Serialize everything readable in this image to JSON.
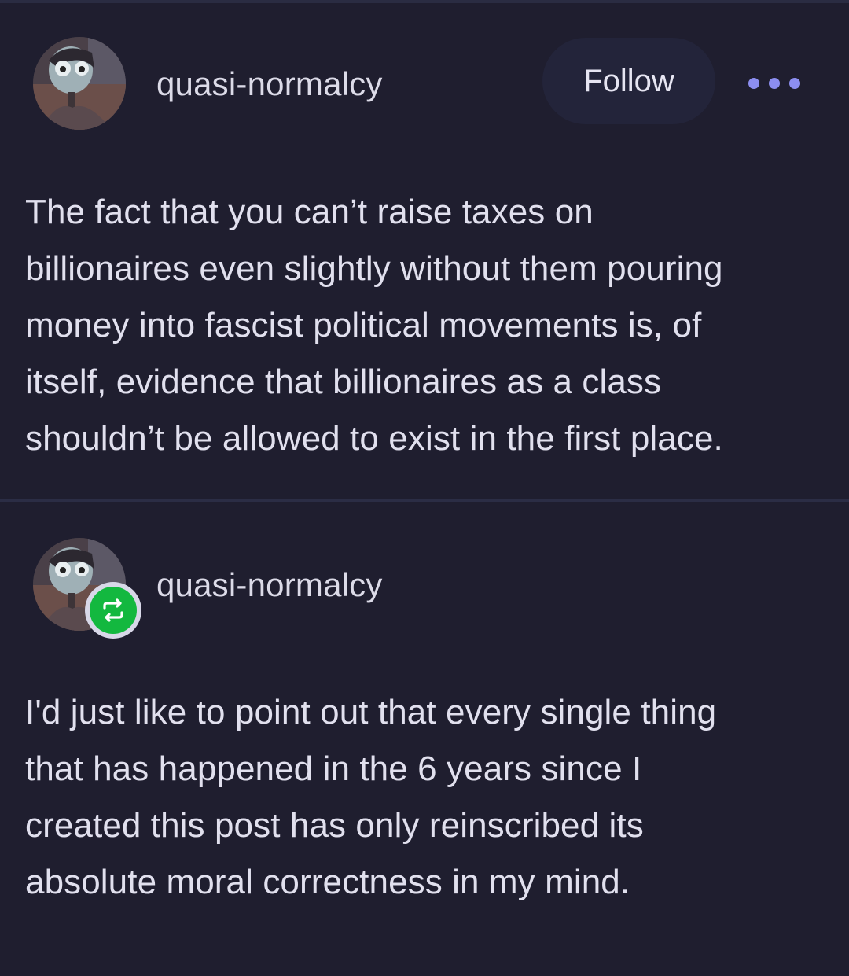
{
  "colors": {
    "background": "#1f1e2f",
    "accent_dots": "#8c8ef0",
    "reblog_green": "#13b83f",
    "follow_button_bg": "#23243a"
  },
  "original_post": {
    "username": "quasi-normalcy",
    "follow_label": "Follow",
    "more_icon": "more-horizontal-icon",
    "body_lines": [
      "The fact that you can’t raise taxes on",
      "billionaires even slightly without them pouring",
      "money into fascist political movements is, of",
      "itself, evidence that billionaires as a class",
      "shouldn’t be allowed to exist in the first place."
    ]
  },
  "reblog": {
    "username": "quasi-normalcy",
    "badge_icon": "reblog-icon",
    "body_lines": [
      "I'd just like to point out that every single thing",
      "that has happened in the 6 years since I",
      "created this post has only reinscribed its",
      "absolute moral correctness in my mind."
    ]
  }
}
